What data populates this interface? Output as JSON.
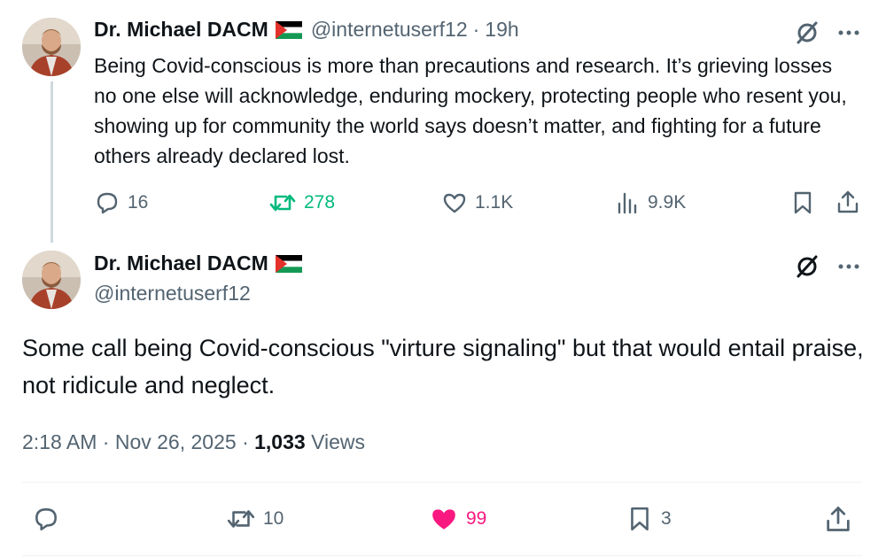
{
  "tweet1": {
    "name": "Dr. Michael DACM",
    "handle": "@internetuserf12",
    "separator": "·",
    "time": "19h",
    "text": "Being Covid-conscious is more than precautions and research. It’s grieving losses no one else will acknowledge, enduring mockery, protecting people who resent you, showing up for community the world says doesn’t matter, and fighting for a future others already declared lost.",
    "replies": "16",
    "reposts": "278",
    "likes": "1.1K",
    "views": "9.9K"
  },
  "tweet2": {
    "name": "Dr. Michael DACM",
    "handle": "@internetuserf12",
    "text": "Some call being Covid-conscious \"virture signaling\" but that would entail praise, not ridicule and neglect.",
    "time": "2:18 AM",
    "date": "Nov 26, 2025",
    "dot": "·",
    "views_count": "1,033",
    "views_label": "Views",
    "reposts": "10",
    "likes": "99",
    "bookmarks": "3"
  },
  "colors": {
    "text": "#0f1419",
    "secondary": "#536471",
    "repost_active": "#00ba7c",
    "like_active": "#f91880",
    "divider": "#eff3f4"
  },
  "icons": [
    "reply-icon",
    "repost-icon",
    "like-icon",
    "views-icon",
    "bookmark-icon",
    "share-icon",
    "grok-icon",
    "more-icon",
    "palestine-flag-icon"
  ]
}
